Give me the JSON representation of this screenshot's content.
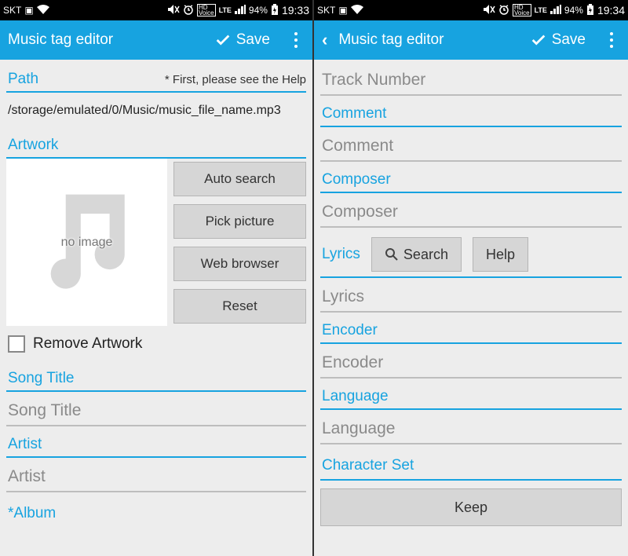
{
  "status": {
    "carrier": "SKT",
    "battery": "94%",
    "hd": "HD",
    "voice": "Voice",
    "lte": "LTE",
    "time_left": "19:33",
    "time_right": "19:34"
  },
  "appbar": {
    "title": "Music tag editor",
    "save": "Save"
  },
  "left": {
    "path_label": "Path",
    "help_note": "* First, please see the Help",
    "path_value": "/storage/emulated/0/Music/music_file_name.mp3",
    "artwork_label": "Artwork",
    "no_image": "no image",
    "btn_auto": "Auto search",
    "btn_pick": "Pick picture",
    "btn_web": "Web browser",
    "btn_reset": "Reset",
    "remove_artwork": "Remove Artwork",
    "song_title_label": "Song Title",
    "song_title_value": "Song Title",
    "artist_label": "Artist",
    "artist_value": "Artist",
    "album_label": "*Album"
  },
  "right": {
    "track_number_value": "Track Number",
    "comment_label": "Comment",
    "comment_value": "Comment",
    "composer_label": "Composer",
    "composer_value": "Composer",
    "lyrics_label": "Lyrics",
    "search_btn": "Search",
    "help_btn": "Help",
    "lyrics_value": "Lyrics",
    "encoder_label": "Encoder",
    "encoder_value": "Encoder",
    "language_label": "Language",
    "language_value": "Language",
    "charset_label": "Character Set",
    "keep_btn": "Keep"
  }
}
